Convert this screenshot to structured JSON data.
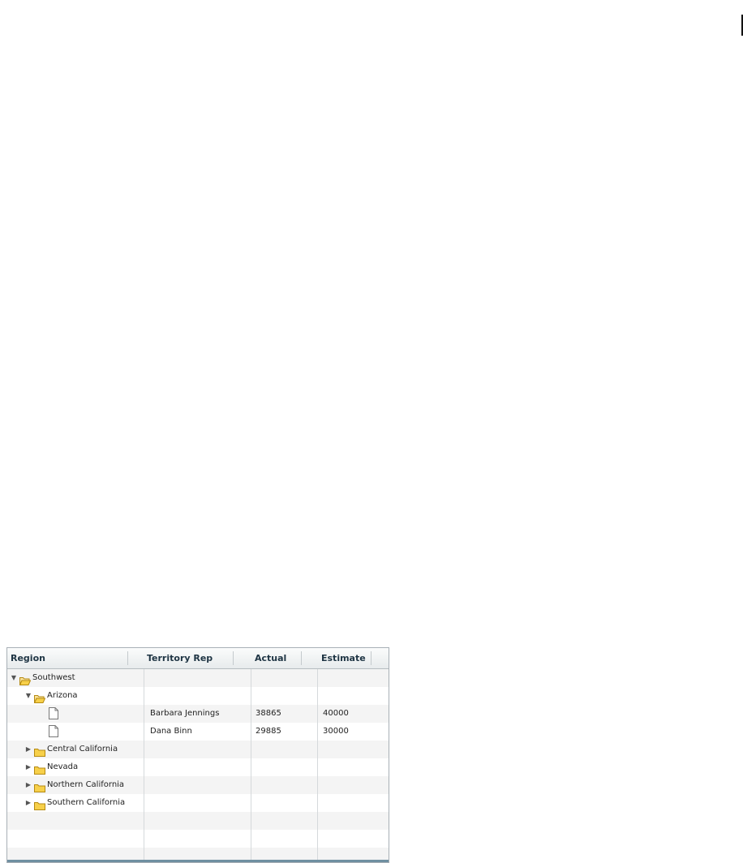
{
  "grid": {
    "columns": [
      "Region",
      "Territory Rep",
      "Actual",
      "Estimate"
    ],
    "rows": [
      {
        "region": "Southwest",
        "type": "folder",
        "state": "expanded",
        "level": 0,
        "rep": "",
        "actual": "",
        "estimate": ""
      },
      {
        "region": "Arizona",
        "type": "folder",
        "state": "expanded",
        "level": 1,
        "rep": "",
        "actual": "",
        "estimate": ""
      },
      {
        "region": "",
        "type": "document",
        "state": "leaf",
        "level": 2,
        "rep": "Barbara Jennings",
        "actual": "38865",
        "estimate": "40000"
      },
      {
        "region": "",
        "type": "document",
        "state": "leaf",
        "level": 2,
        "rep": "Dana Binn",
        "actual": "29885",
        "estimate": "30000"
      },
      {
        "region": "Central California",
        "type": "folder",
        "state": "collapsed",
        "level": 1,
        "rep": "",
        "actual": "",
        "estimate": ""
      },
      {
        "region": "Nevada",
        "type": "folder",
        "state": "collapsed",
        "level": 1,
        "rep": "",
        "actual": "",
        "estimate": ""
      },
      {
        "region": "Northern California",
        "type": "folder",
        "state": "collapsed",
        "level": 1,
        "rep": "",
        "actual": "",
        "estimate": ""
      },
      {
        "region": "Southern California",
        "type": "folder",
        "state": "collapsed",
        "level": 1,
        "rep": "",
        "actual": "",
        "estimate": ""
      }
    ],
    "icons": {
      "expanded": "triangle-down-icon",
      "collapsed": "triangle-right-icon",
      "folder": "folder-icon",
      "open_folder": "folder-open-icon",
      "document": "document-icon"
    },
    "colors": {
      "header_text": "#1f3544",
      "folder_fill": "#f7d04a",
      "footer": "#6f8fa1"
    }
  }
}
